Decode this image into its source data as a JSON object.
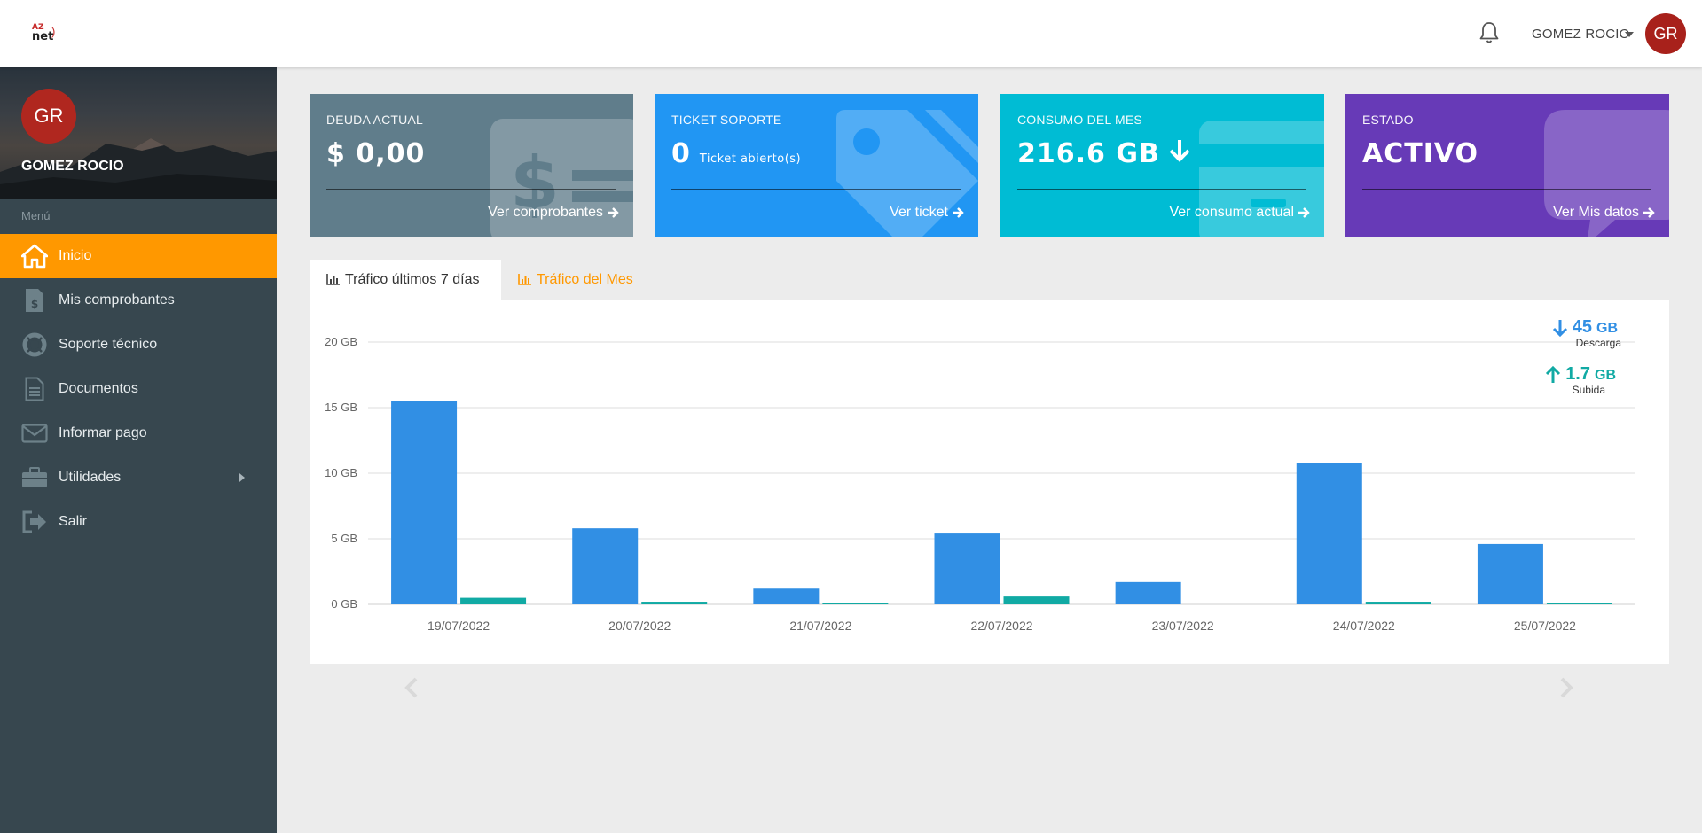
{
  "header": {
    "logo": {
      "line1": "AZ",
      "line2": "net",
      "mark": ")"
    },
    "user_name": "GOMEZ ROCIO",
    "avatar_initials": "GR"
  },
  "sidebar": {
    "avatar_initials": "GR",
    "user_name": "GOMEZ ROCIO",
    "menu_label": "Menú",
    "items": [
      {
        "label": "Inicio",
        "icon": "home-icon",
        "active": true
      },
      {
        "label": "Mis comprobantes",
        "icon": "invoice-icon"
      },
      {
        "label": "Soporte técnico",
        "icon": "life-ring-icon"
      },
      {
        "label": "Documentos",
        "icon": "document-icon"
      },
      {
        "label": "Informar pago",
        "icon": "envelope-icon"
      },
      {
        "label": "Utilidades",
        "icon": "toolbox-icon",
        "has_submenu": true
      },
      {
        "label": "Salir",
        "icon": "sign-out-icon"
      }
    ]
  },
  "cards": [
    {
      "title": "DEUDA ACTUAL",
      "value": "$ 0,00",
      "sub": "",
      "link": "Ver comprobantes",
      "color": "#607d8b",
      "icon": "dollar-invoice-icon"
    },
    {
      "title": "TICKET SOPORTE",
      "value": "0",
      "sub": "Ticket abierto(s)",
      "link": "Ver ticket",
      "color": "#2196f3",
      "icon": "tag-icon"
    },
    {
      "title": "CONSUMO DEL MES",
      "value": "216.6 GB",
      "sub": "",
      "link": "Ver consumo actual",
      "color": "#00bcd4",
      "icon": "credit-card-icon"
    },
    {
      "title": "ESTADO",
      "value": "ACTIVO",
      "sub": "",
      "link": "Ver Mis datos",
      "color": "#673ab7",
      "icon": "speech-bubble-icon"
    }
  ],
  "tabs": [
    {
      "label": "Tráfico últimos 7 días",
      "active": true
    },
    {
      "label": "Tráfico del Mes",
      "active": false
    }
  ],
  "chart_legend": {
    "download": {
      "value": "45",
      "unit": "GB",
      "label": "Descarga",
      "color": "#318fe4"
    },
    "upload": {
      "value": "1.7",
      "unit": "GB",
      "label": "Subida",
      "color": "#11aaa4"
    }
  },
  "chart_data": {
    "type": "bar",
    "categories": [
      "19/07/2022",
      "20/07/2022",
      "21/07/2022",
      "22/07/2022",
      "23/07/2022",
      "24/07/2022",
      "25/07/2022"
    ],
    "series": [
      {
        "name": "Descarga",
        "color": "#318fe4",
        "values": [
          15.5,
          5.8,
          1.2,
          5.4,
          1.7,
          10.8,
          4.6
        ]
      },
      {
        "name": "Subida",
        "color": "#11aaa4",
        "values": [
          0.5,
          0.2,
          0.1,
          0.6,
          0.0,
          0.2,
          0.1
        ]
      }
    ],
    "yticks": [
      "0 GB",
      "5 GB",
      "10 GB",
      "15 GB",
      "20 GB"
    ],
    "ylim": [
      0,
      20
    ],
    "grid": true
  }
}
